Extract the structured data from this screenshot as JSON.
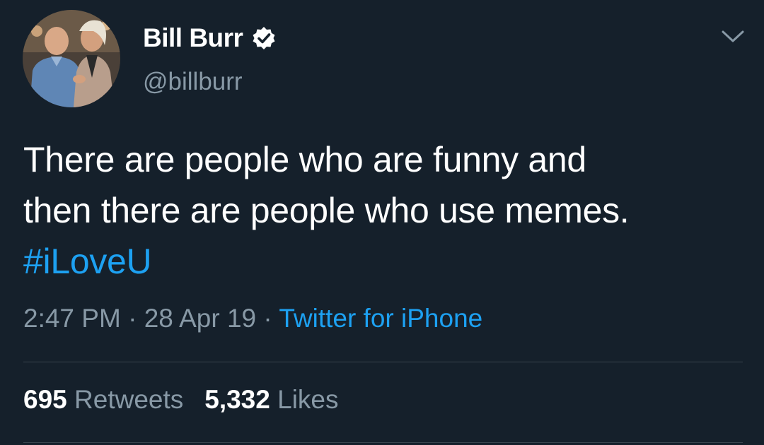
{
  "author": {
    "display_name": "Bill Burr",
    "handle": "@billburr",
    "verified": true
  },
  "tweet": {
    "lines": [
      "There are people who are funny and",
      "then there are people who use memes."
    ],
    "hashtag": "#iLoveU"
  },
  "meta": {
    "time": "2:47 PM",
    "sep1": " · ",
    "date": "28 Apr 19",
    "sep2": " · ",
    "source": "Twitter for iPhone"
  },
  "stats": {
    "retweets_count": "695",
    "retweets_label": "Retweets",
    "likes_count": "5,332",
    "likes_label": "Likes"
  },
  "colors": {
    "background": "#15202b",
    "link": "#1da1f2",
    "secondary_text": "#8899a6"
  },
  "icons": {
    "verified": "verified-badge-icon",
    "menu": "chevron-down-icon"
  }
}
